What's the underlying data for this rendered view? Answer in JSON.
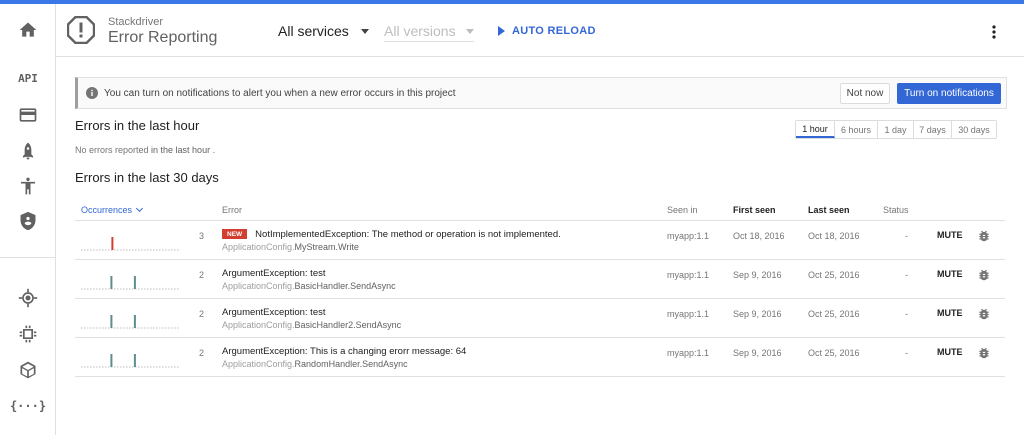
{
  "colors": {
    "accent": "#3367d6",
    "top_bar": "#3b78e7",
    "new_badge": "#d23f31",
    "spark_red": "#d23f31",
    "spark_teal": "#5f8c8c"
  },
  "nav": {
    "items": [
      {
        "name": "home-icon"
      },
      {
        "name": "api",
        "label": "API"
      },
      {
        "name": "billing-icon"
      },
      {
        "name": "deploy-icon"
      },
      {
        "name": "iam-icon"
      },
      {
        "name": "security-icon"
      },
      {
        "name": "monitoring-icon"
      },
      {
        "name": "compute-icon"
      },
      {
        "name": "app-engine-icon"
      },
      {
        "name": "functions",
        "label": "{···}"
      }
    ]
  },
  "header": {
    "brand_small": "Stackdriver",
    "brand_title": "Error Reporting",
    "services": "All services",
    "versions": "All versions",
    "auto_reload": "AUTO RELOAD"
  },
  "banner": {
    "text": "You can turn on notifications to alert you when a new error occurs in this project",
    "not_now": "Not now",
    "turn_on": "Turn on notifications"
  },
  "last_hour": {
    "title": "Errors in the last hour",
    "empty_prefix": "No errors reported ",
    "empty_bold": "in the last hour",
    "empty_suffix": " .",
    "ranges": [
      "1 hour",
      "6 hours",
      "1 day",
      "7 days",
      "30 days"
    ],
    "active_range": "1 hour"
  },
  "last_30": {
    "title": "Errors in the last 30 days"
  },
  "table": {
    "columns": {
      "occurrences": "Occurrences",
      "error": "Error",
      "seen_in": "Seen in",
      "first_seen": "First seen",
      "last_seen": "Last seen",
      "status": "Status"
    },
    "rows": [
      {
        "count": "3",
        "is_new": true,
        "new_label": "NEW",
        "title": "NotImplementedException: The method or operation is not implemented.",
        "source_prefix": "ApplicationConfig.",
        "source_member": "MyStream.Write",
        "seen_in": "myapp:1.1",
        "first_seen": "Oct 18, 2016",
        "last_seen": "Oct 18, 2016",
        "status": "-",
        "action": "MUTE",
        "spark": [
          {
            "pos": 0.31,
            "color": "red"
          }
        ]
      },
      {
        "count": "2",
        "is_new": false,
        "title": "ArgumentException: test",
        "source_prefix": "ApplicationConfig.",
        "source_member": "BasicHandler.SendAsync",
        "seen_in": "myapp:1.1",
        "first_seen": "Sep 9, 2016",
        "last_seen": "Oct 25, 2016",
        "status": "-",
        "action": "MUTE",
        "spark": [
          {
            "pos": 0.3,
            "color": "teal"
          },
          {
            "pos": 0.54,
            "color": "teal"
          }
        ]
      },
      {
        "count": "2",
        "is_new": false,
        "title": "ArgumentException: test",
        "source_prefix": "ApplicationConfig.",
        "source_member": "BasicHandler2.SendAsync",
        "seen_in": "myapp:1.1",
        "first_seen": "Sep 9, 2016",
        "last_seen": "Oct 25, 2016",
        "status": "-",
        "action": "MUTE",
        "spark": [
          {
            "pos": 0.3,
            "color": "teal"
          },
          {
            "pos": 0.54,
            "color": "teal"
          }
        ]
      },
      {
        "count": "2",
        "is_new": false,
        "title": "ArgumentException: This is a changing erorr message: 64",
        "source_prefix": "ApplicationConfig.",
        "source_member": "RandomHandler.SendAsync",
        "seen_in": "myapp:1.1",
        "first_seen": "Sep 9, 2016",
        "last_seen": "Oct 25, 2016",
        "status": "-",
        "action": "MUTE",
        "spark": [
          {
            "pos": 0.3,
            "color": "teal"
          },
          {
            "pos": 0.54,
            "color": "teal"
          }
        ]
      }
    ]
  }
}
